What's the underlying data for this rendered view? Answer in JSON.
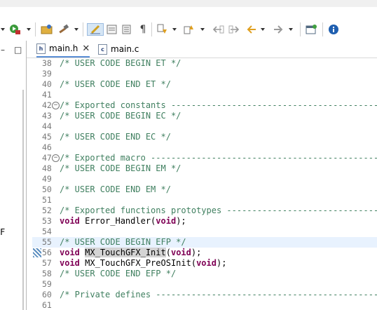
{
  "toolbar": {
    "icons": [
      "run-debug-icon",
      "run-dropdown-icon",
      "open-folder-icon",
      "build-hammer-icon",
      "toggle-mark-icon",
      "next-annotation-icon",
      "prev-annotation-icon",
      "show-whitespace-icon",
      "nav-down-icon",
      "nav-up-icon",
      "back-icon",
      "forward-icon",
      "history-back-icon",
      "history-forward-icon",
      "open-perspective-icon",
      "info-icon"
    ],
    "pilcrow": "¶"
  },
  "left_pane": {
    "minimize": "–",
    "maximize": "□",
    "clip_char": "F"
  },
  "tabs": [
    {
      "label": "main.h",
      "icon": "h",
      "active": true,
      "close": "✕"
    },
    {
      "label": "main.c",
      "icon": "c",
      "active": false
    }
  ],
  "lines": [
    {
      "num": "38",
      "fold": false,
      "parts": [
        {
          "t": "/* USER CODE BEGIN ET */",
          "k": "com"
        }
      ]
    },
    {
      "num": "39",
      "fold": false,
      "parts": []
    },
    {
      "num": "40",
      "fold": false,
      "parts": [
        {
          "t": "/* USER CODE END ET */",
          "k": "com"
        }
      ]
    },
    {
      "num": "41",
      "fold": false,
      "parts": []
    },
    {
      "num": "42",
      "fold": true,
      "parts": [
        {
          "t": "/* Exported constants -----------------------------------------------",
          "k": "com"
        }
      ]
    },
    {
      "num": "43",
      "fold": false,
      "parts": [
        {
          "t": "/* USER CODE BEGIN EC */",
          "k": "com"
        }
      ]
    },
    {
      "num": "44",
      "fold": false,
      "parts": []
    },
    {
      "num": "45",
      "fold": false,
      "parts": [
        {
          "t": "/* USER CODE END EC */",
          "k": "com"
        }
      ]
    },
    {
      "num": "46",
      "fold": false,
      "parts": []
    },
    {
      "num": "47",
      "fold": true,
      "parts": [
        {
          "t": "/* Exported macro ---------------------------------------------------",
          "k": "com"
        }
      ]
    },
    {
      "num": "48",
      "fold": false,
      "parts": [
        {
          "t": "/* USER CODE BEGIN EM */",
          "k": "com"
        }
      ]
    },
    {
      "num": "49",
      "fold": false,
      "parts": []
    },
    {
      "num": "50",
      "fold": false,
      "parts": [
        {
          "t": "/* USER CODE END EM */",
          "k": "com"
        }
      ]
    },
    {
      "num": "51",
      "fold": false,
      "parts": []
    },
    {
      "num": "52",
      "fold": false,
      "parts": [
        {
          "t": "/* Exported functions prototypes ------------------------------------",
          "k": "com"
        }
      ]
    },
    {
      "num": "53",
      "fold": false,
      "parts": [
        {
          "t": "void",
          "k": "kw"
        },
        {
          "t": " Error_Handler(",
          "k": "id"
        },
        {
          "t": "void",
          "k": "kw"
        },
        {
          "t": ");",
          "k": "id"
        }
      ]
    },
    {
      "num": "54",
      "fold": false,
      "parts": []
    },
    {
      "num": "55",
      "fold": false,
      "hl": true,
      "parts": [
        {
          "t": "/* USER CODE BEGIN EFP */",
          "k": "com"
        }
      ]
    },
    {
      "num": "56",
      "fold": false,
      "bookmark": true,
      "parts": [
        {
          "t": "void",
          "k": "kw"
        },
        {
          "t": " ",
          "k": "id"
        },
        {
          "t": "MX_TouchGFX_Init",
          "k": "sel"
        },
        {
          "t": "(",
          "k": "id"
        },
        {
          "t": "void",
          "k": "kw"
        },
        {
          "t": ");",
          "k": "id"
        }
      ]
    },
    {
      "num": "57",
      "fold": false,
      "parts": [
        {
          "t": "void",
          "k": "kw"
        },
        {
          "t": " MX_TouchGFX_PreOSInit(",
          "k": "id"
        },
        {
          "t": "void",
          "k": "kw"
        },
        {
          "t": ");",
          "k": "id"
        }
      ]
    },
    {
      "num": "58",
      "fold": false,
      "parts": [
        {
          "t": "/* USER CODE END EFP */",
          "k": "com"
        }
      ]
    },
    {
      "num": "59",
      "fold": false,
      "parts": []
    },
    {
      "num": "60",
      "fold": false,
      "parts": [
        {
          "t": "/* Private defines --------------------------------------------------",
          "k": "com"
        }
      ]
    },
    {
      "num": "61",
      "fold": false,
      "parts": []
    }
  ]
}
